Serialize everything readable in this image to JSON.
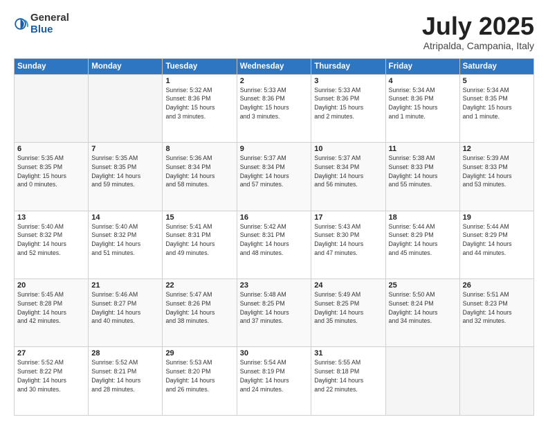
{
  "logo": {
    "general": "General",
    "blue": "Blue"
  },
  "title": "July 2025",
  "location": "Atripalda, Campania, Italy",
  "weekdays": [
    "Sunday",
    "Monday",
    "Tuesday",
    "Wednesday",
    "Thursday",
    "Friday",
    "Saturday"
  ],
  "weeks": [
    [
      {
        "day": "",
        "info": ""
      },
      {
        "day": "",
        "info": ""
      },
      {
        "day": "1",
        "info": "Sunrise: 5:32 AM\nSunset: 8:36 PM\nDaylight: 15 hours\nand 3 minutes."
      },
      {
        "day": "2",
        "info": "Sunrise: 5:33 AM\nSunset: 8:36 PM\nDaylight: 15 hours\nand 3 minutes."
      },
      {
        "day": "3",
        "info": "Sunrise: 5:33 AM\nSunset: 8:36 PM\nDaylight: 15 hours\nand 2 minutes."
      },
      {
        "day": "4",
        "info": "Sunrise: 5:34 AM\nSunset: 8:36 PM\nDaylight: 15 hours\nand 1 minute."
      },
      {
        "day": "5",
        "info": "Sunrise: 5:34 AM\nSunset: 8:35 PM\nDaylight: 15 hours\nand 1 minute."
      }
    ],
    [
      {
        "day": "6",
        "info": "Sunrise: 5:35 AM\nSunset: 8:35 PM\nDaylight: 15 hours\nand 0 minutes."
      },
      {
        "day": "7",
        "info": "Sunrise: 5:35 AM\nSunset: 8:35 PM\nDaylight: 14 hours\nand 59 minutes."
      },
      {
        "day": "8",
        "info": "Sunrise: 5:36 AM\nSunset: 8:34 PM\nDaylight: 14 hours\nand 58 minutes."
      },
      {
        "day": "9",
        "info": "Sunrise: 5:37 AM\nSunset: 8:34 PM\nDaylight: 14 hours\nand 57 minutes."
      },
      {
        "day": "10",
        "info": "Sunrise: 5:37 AM\nSunset: 8:34 PM\nDaylight: 14 hours\nand 56 minutes."
      },
      {
        "day": "11",
        "info": "Sunrise: 5:38 AM\nSunset: 8:33 PM\nDaylight: 14 hours\nand 55 minutes."
      },
      {
        "day": "12",
        "info": "Sunrise: 5:39 AM\nSunset: 8:33 PM\nDaylight: 14 hours\nand 53 minutes."
      }
    ],
    [
      {
        "day": "13",
        "info": "Sunrise: 5:40 AM\nSunset: 8:32 PM\nDaylight: 14 hours\nand 52 minutes."
      },
      {
        "day": "14",
        "info": "Sunrise: 5:40 AM\nSunset: 8:32 PM\nDaylight: 14 hours\nand 51 minutes."
      },
      {
        "day": "15",
        "info": "Sunrise: 5:41 AM\nSunset: 8:31 PM\nDaylight: 14 hours\nand 49 minutes."
      },
      {
        "day": "16",
        "info": "Sunrise: 5:42 AM\nSunset: 8:31 PM\nDaylight: 14 hours\nand 48 minutes."
      },
      {
        "day": "17",
        "info": "Sunrise: 5:43 AM\nSunset: 8:30 PM\nDaylight: 14 hours\nand 47 minutes."
      },
      {
        "day": "18",
        "info": "Sunrise: 5:44 AM\nSunset: 8:29 PM\nDaylight: 14 hours\nand 45 minutes."
      },
      {
        "day": "19",
        "info": "Sunrise: 5:44 AM\nSunset: 8:29 PM\nDaylight: 14 hours\nand 44 minutes."
      }
    ],
    [
      {
        "day": "20",
        "info": "Sunrise: 5:45 AM\nSunset: 8:28 PM\nDaylight: 14 hours\nand 42 minutes."
      },
      {
        "day": "21",
        "info": "Sunrise: 5:46 AM\nSunset: 8:27 PM\nDaylight: 14 hours\nand 40 minutes."
      },
      {
        "day": "22",
        "info": "Sunrise: 5:47 AM\nSunset: 8:26 PM\nDaylight: 14 hours\nand 38 minutes."
      },
      {
        "day": "23",
        "info": "Sunrise: 5:48 AM\nSunset: 8:25 PM\nDaylight: 14 hours\nand 37 minutes."
      },
      {
        "day": "24",
        "info": "Sunrise: 5:49 AM\nSunset: 8:25 PM\nDaylight: 14 hours\nand 35 minutes."
      },
      {
        "day": "25",
        "info": "Sunrise: 5:50 AM\nSunset: 8:24 PM\nDaylight: 14 hours\nand 34 minutes."
      },
      {
        "day": "26",
        "info": "Sunrise: 5:51 AM\nSunset: 8:23 PM\nDaylight: 14 hours\nand 32 minutes."
      }
    ],
    [
      {
        "day": "27",
        "info": "Sunrise: 5:52 AM\nSunset: 8:22 PM\nDaylight: 14 hours\nand 30 minutes."
      },
      {
        "day": "28",
        "info": "Sunrise: 5:52 AM\nSunset: 8:21 PM\nDaylight: 14 hours\nand 28 minutes."
      },
      {
        "day": "29",
        "info": "Sunrise: 5:53 AM\nSunset: 8:20 PM\nDaylight: 14 hours\nand 26 minutes."
      },
      {
        "day": "30",
        "info": "Sunrise: 5:54 AM\nSunset: 8:19 PM\nDaylight: 14 hours\nand 24 minutes."
      },
      {
        "day": "31",
        "info": "Sunrise: 5:55 AM\nSunset: 8:18 PM\nDaylight: 14 hours\nand 22 minutes."
      },
      {
        "day": "",
        "info": ""
      },
      {
        "day": "",
        "info": ""
      }
    ]
  ]
}
